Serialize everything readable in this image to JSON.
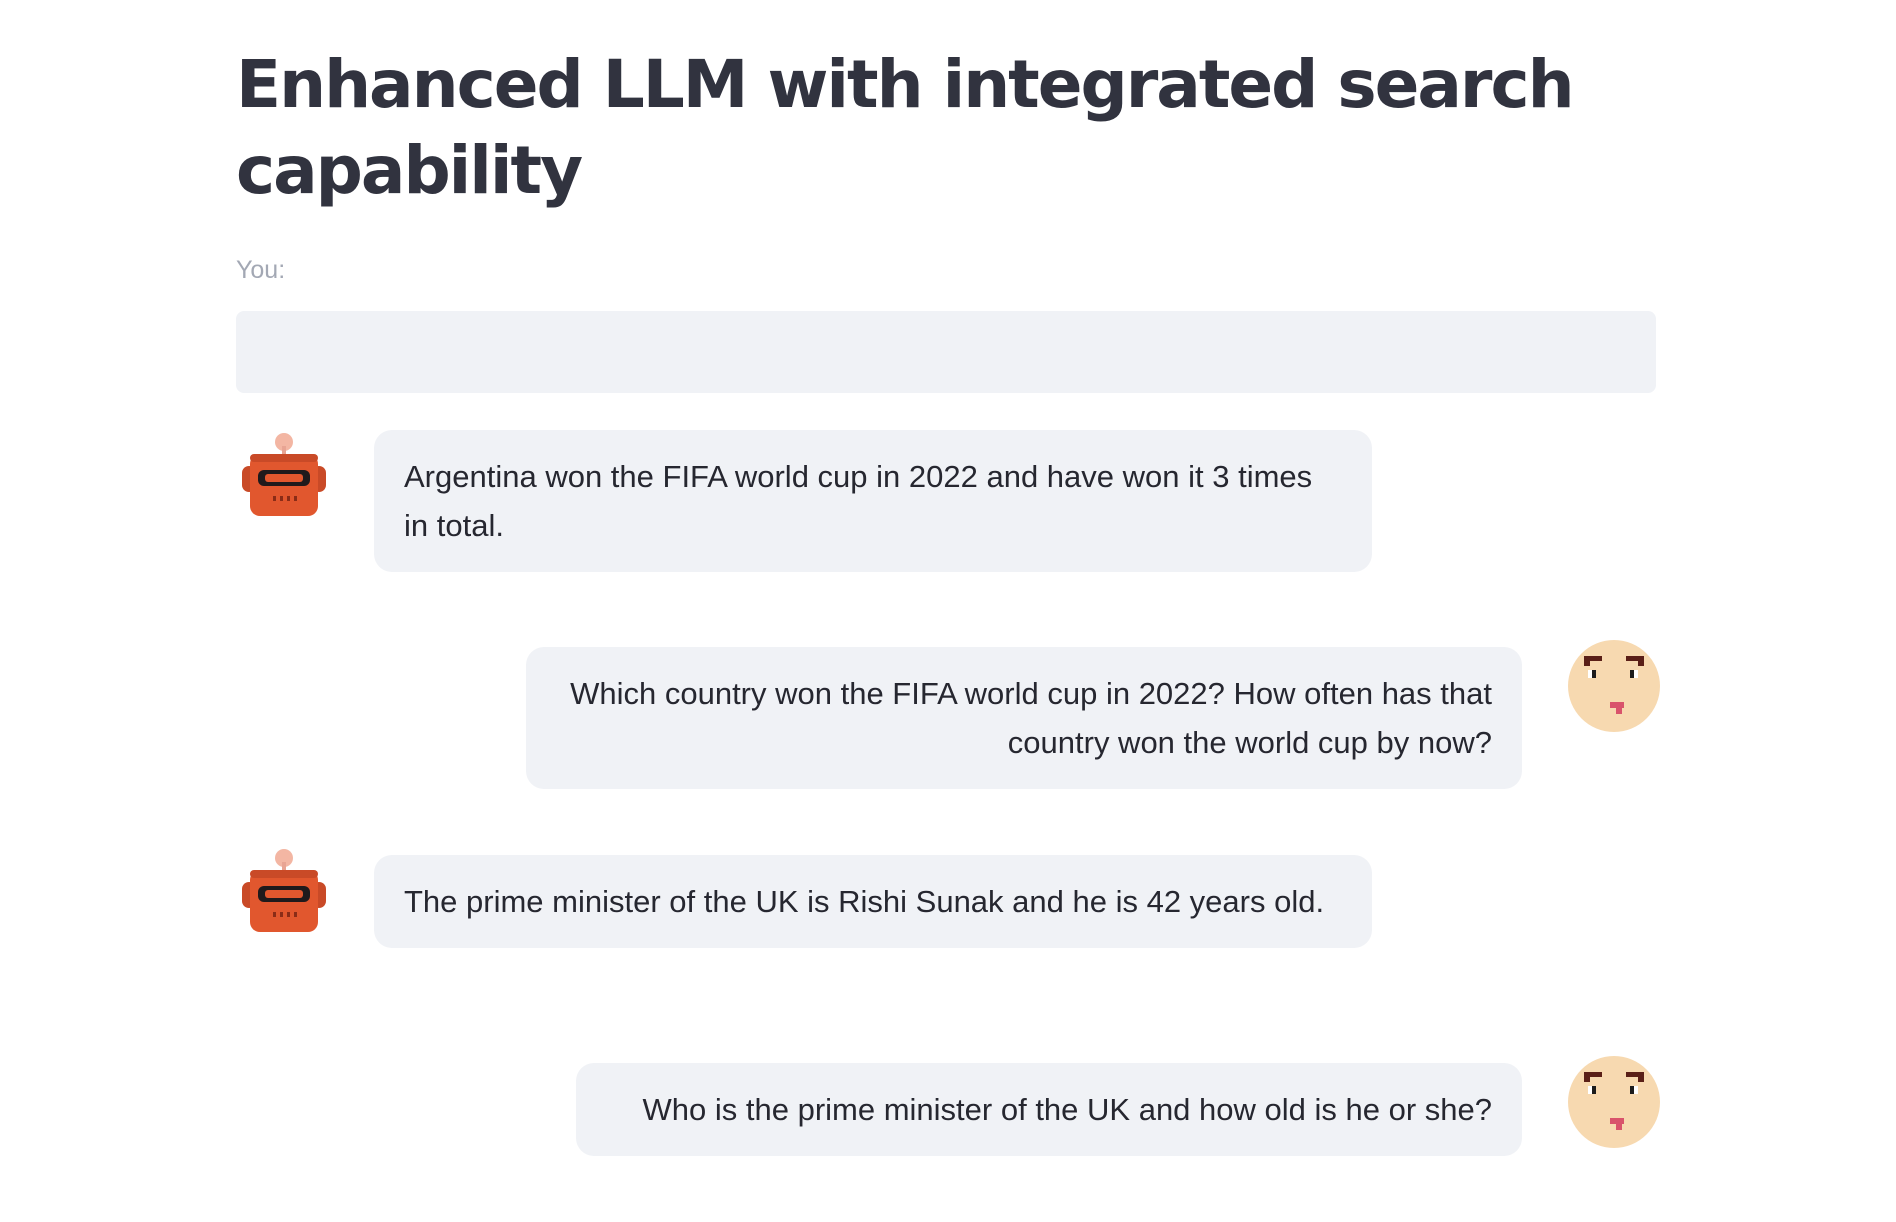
{
  "page": {
    "title": "Enhanced LLM with integrated search capability"
  },
  "input": {
    "label": "You:",
    "value": ""
  },
  "messages": [
    {
      "role": "bot",
      "avatar": "robot-icon",
      "text": "Argentina won the FIFA world cup in 2022 and have won it 3 times in total."
    },
    {
      "role": "user",
      "avatar": "face-icon",
      "text": "Which country won the FIFA world cup in 2022? How often has that country won the world cup by now?"
    },
    {
      "role": "bot",
      "avatar": "robot-icon",
      "text": "The prime minister of the UK is Rishi Sunak and he is 42 years old."
    },
    {
      "role": "user",
      "avatar": "face-icon",
      "text": "Who is the prime minister of the UK and how old is he or she?"
    }
  ],
  "colors": {
    "bubble_bg": "#f0f2f6",
    "text": "#262730",
    "label": "#a3a8b4",
    "robot": "#e1572e",
    "face": "#f7d9b0"
  }
}
